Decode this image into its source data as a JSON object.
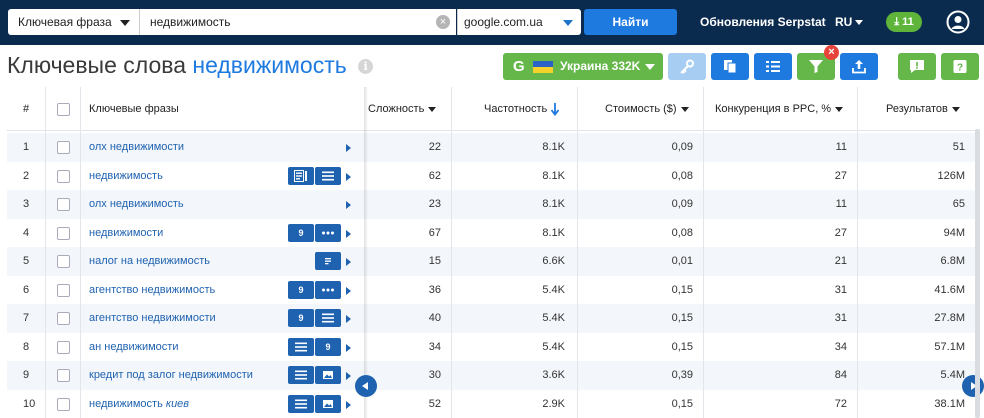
{
  "topbar": {
    "mode_label": "Ключевая фраза",
    "search_value": "недвижимость",
    "domain_value": "google.com.ua",
    "find_label": "Найти",
    "updates_label": "Обновления Serpstat",
    "lang_label": "RU",
    "downloads_count": "11"
  },
  "title": {
    "prefix": "Ключевые слова",
    "query": "недвижимость",
    "info": "i"
  },
  "toolbar": {
    "region_g": "G",
    "region_label": "Украина 332K"
  },
  "table": {
    "headers": {
      "num": "#",
      "keyword": "Ключевые фразы",
      "difficulty": "Сложность",
      "frequency": "Частотность",
      "cost": "Стоимость ($)",
      "competition": "Конкуренция в PPC, %",
      "results": "Результатов"
    },
    "rows": [
      {
        "num": "1",
        "keyword": "олх недвижимости",
        "keyword_italic": "",
        "difficulty": "22",
        "frequency": "8.1K",
        "cost": "0,09",
        "competition": "11",
        "results": "51",
        "features": []
      },
      {
        "num": "2",
        "keyword": "недвижимость",
        "keyword_italic": "",
        "difficulty": "62",
        "frequency": "8.1K",
        "cost": "0,08",
        "competition": "27",
        "results": "126M",
        "features": [
          "card",
          "list"
        ]
      },
      {
        "num": "3",
        "keyword": "олх недвижимость",
        "keyword_italic": "",
        "difficulty": "23",
        "frequency": "8.1K",
        "cost": "0,09",
        "competition": "11",
        "results": "65",
        "features": []
      },
      {
        "num": "4",
        "keyword": "недвижимости",
        "keyword_italic": "",
        "difficulty": "67",
        "frequency": "8.1K",
        "cost": "0,08",
        "competition": "27",
        "results": "94M",
        "features": [
          "nine",
          "dots"
        ]
      },
      {
        "num": "5",
        "keyword": "налог на недвижимость",
        "keyword_italic": "",
        "difficulty": "15",
        "frequency": "6.6K",
        "cost": "0,01",
        "competition": "21",
        "results": "6.8M",
        "features": [
          "snippet"
        ]
      },
      {
        "num": "6",
        "keyword": "агентство недвижимость",
        "keyword_italic": "",
        "difficulty": "36",
        "frequency": "5.4K",
        "cost": "0,15",
        "competition": "31",
        "results": "41.6M",
        "features": [
          "nine",
          "dots"
        ]
      },
      {
        "num": "7",
        "keyword": "агентство недвижимости",
        "keyword_italic": "",
        "difficulty": "40",
        "frequency": "5.4K",
        "cost": "0,15",
        "competition": "31",
        "results": "27.8M",
        "features": [
          "nine",
          "list"
        ]
      },
      {
        "num": "8",
        "keyword": "ан недвижимости",
        "keyword_italic": "",
        "difficulty": "34",
        "frequency": "5.4K",
        "cost": "0,15",
        "competition": "34",
        "results": "57.1M",
        "features": [
          "list",
          "nine"
        ]
      },
      {
        "num": "9",
        "keyword": "кредит под залог недвижимости",
        "keyword_italic": "",
        "difficulty": "30",
        "frequency": "3.6K",
        "cost": "0,39",
        "competition": "84",
        "results": "5.4M",
        "features": [
          "list",
          "image"
        ]
      },
      {
        "num": "10",
        "keyword": "недвижимость ",
        "keyword_italic": "киев",
        "difficulty": "52",
        "frequency": "2.9K",
        "cost": "0,15",
        "competition": "72",
        "results": "38.1M",
        "features": [
          "list",
          "image"
        ]
      }
    ]
  },
  "feature_icons": {
    "nine": "9",
    "card": "card-icon",
    "list": "list-icon",
    "dots": "dots-icon",
    "snippet": "snippet-icon",
    "image": "image-icon"
  },
  "colors": {
    "topbar": "#0b2b4e",
    "accent_blue": "#1f7ae0",
    "green": "#65b74a",
    "link": "#1f62b0"
  }
}
